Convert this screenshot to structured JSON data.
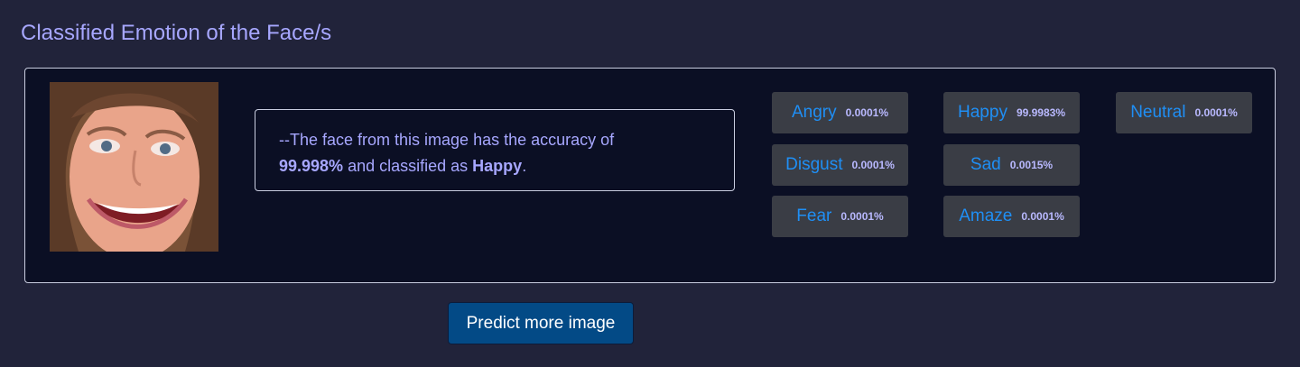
{
  "page": {
    "section_title": "Classified Emotion of the Face/s"
  },
  "result": {
    "summary_prefix": "--The face from this image has the accuracy of",
    "accuracy": "99.998%",
    "summary_middle": "and classified as",
    "emotion": "Happy",
    "summary_suffix": "."
  },
  "emotions": {
    "angry": {
      "label": "Angry",
      "value": "0.0001%"
    },
    "happy": {
      "label": "Happy",
      "value": "99.9983%"
    },
    "neutral": {
      "label": "Neutral",
      "value": "0.0001%"
    },
    "disgust": {
      "label": "Disgust",
      "value": "0.0001%"
    },
    "sad": {
      "label": "Sad",
      "value": "0.0015%"
    },
    "fear": {
      "label": "Fear",
      "value": "0.0001%"
    },
    "amaze": {
      "label": "Amaze",
      "value": "0.0001%"
    }
  },
  "actions": {
    "predict_more_label": "Predict more image"
  },
  "colors": {
    "background": "#21233a",
    "card": "#0b0f24",
    "title": "#a7a7ff",
    "chip": "#3a3d45",
    "chip_label": "#1f8ff5",
    "button": "#034a86"
  },
  "icons": {
    "face": "face-photo"
  }
}
